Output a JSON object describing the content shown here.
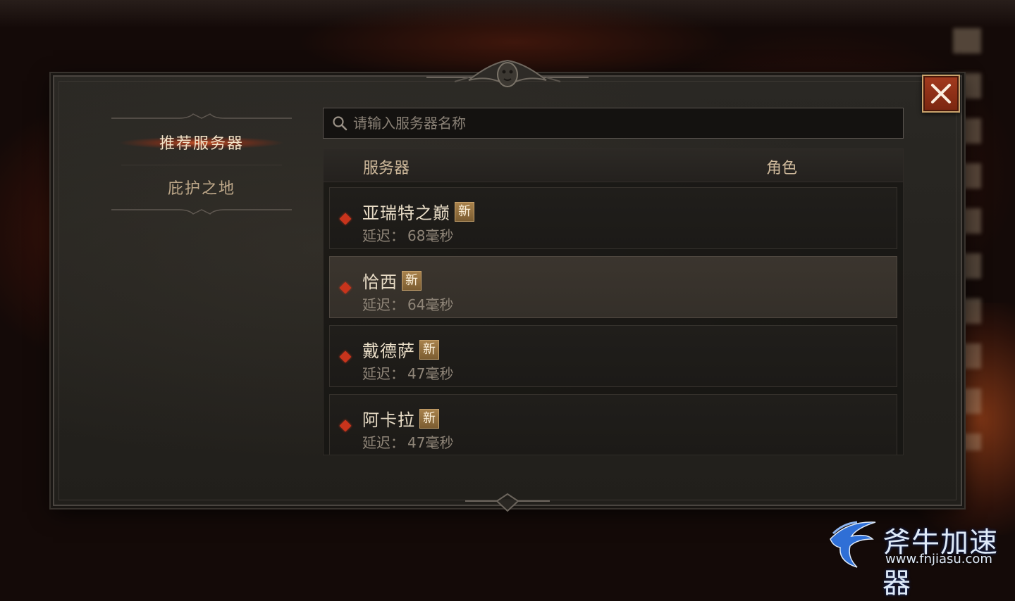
{
  "nav": {
    "items": [
      {
        "label": "推荐服务器",
        "active": true
      },
      {
        "label": "庇护之地",
        "active": false
      }
    ]
  },
  "search": {
    "placeholder": "请输入服务器名称",
    "value": ""
  },
  "list": {
    "columns": {
      "server": "服务器",
      "role": "角色"
    },
    "latency_label": "延迟：",
    "rows": [
      {
        "name": "亚瑞特之巅",
        "badge": "新",
        "latency": "68毫秒",
        "selected": false
      },
      {
        "name": "恰西",
        "badge": "新",
        "latency": "64毫秒",
        "selected": true
      },
      {
        "name": "戴德萨",
        "badge": "新",
        "latency": "47毫秒",
        "selected": false
      },
      {
        "name": "阿卡拉",
        "badge": "新",
        "latency": "47毫秒",
        "selected": false
      }
    ]
  },
  "watermark": {
    "title": "斧牛加速器",
    "url": "www.fnjiasu.com"
  },
  "colors": {
    "accent_red": "#c8341c",
    "badge_gold": "#a8824c",
    "close_button": "#a33a1e",
    "text_primary": "#e8dcc6",
    "text_muted": "#8f8578"
  },
  "icons": [
    "close-icon",
    "search-icon",
    "diamond-marker-icon",
    "crest-ornament-icon",
    "fnjiasu-logo-icon"
  ]
}
